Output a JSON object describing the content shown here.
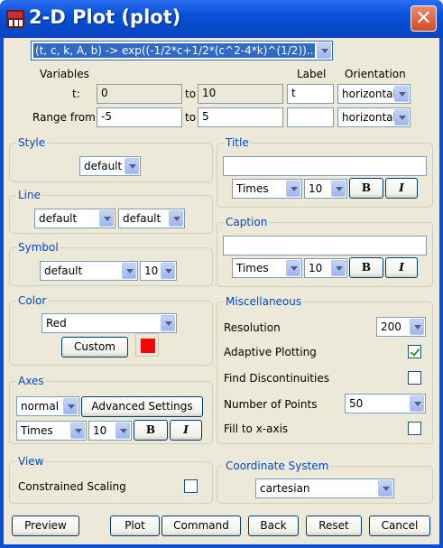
{
  "window": {
    "title": "2-D Plot (plot)",
    "close_glyph": "✕"
  },
  "expression": "(t, c, k, A, b) -> exp((-1/2*c+1/2*(c^2-4*k)^(1/2))...",
  "variables": {
    "header_variables": "Variables",
    "header_label": "Label",
    "header_orientation": "Orientation",
    "t_label": "t:",
    "t_from": "0",
    "to_word": "to",
    "t_to": "10",
    "t_axis_label": "t",
    "t_orientation": "horizontal",
    "range_label": "Range from",
    "range_from": "-5",
    "range_to": "5",
    "range_axis_label": "",
    "range_orientation": "horizontal"
  },
  "style": {
    "title": "Style",
    "value": "default"
  },
  "line": {
    "title": "Line",
    "style1": "default",
    "style2": "default"
  },
  "symbol": {
    "title": "Symbol",
    "value": "default",
    "size": "10"
  },
  "color": {
    "title": "Color",
    "value": "Red",
    "custom_label": "Custom",
    "swatch": "#ff0000"
  },
  "axes": {
    "title": "Axes",
    "type": "normal",
    "advanced_label": "Advanced Settings",
    "font": "Times",
    "size": "10",
    "bold_label": "B",
    "italic_label": "I"
  },
  "view": {
    "title": "View",
    "constrained_label": "Constrained Scaling",
    "constrained_checked": false
  },
  "title_group": {
    "title": "Title",
    "value": "",
    "font": "Times",
    "size": "10",
    "bold_label": "B",
    "italic_label": "I"
  },
  "caption_group": {
    "title": "Caption",
    "value": "",
    "font": "Times",
    "size": "10",
    "bold_label": "B",
    "italic_label": "I"
  },
  "misc": {
    "title": "Miscellaneous",
    "resolution_label": "Resolution",
    "resolution": "200",
    "adaptive_label": "Adaptive Plotting",
    "adaptive_checked": true,
    "discont_label": "Find Discontinuities",
    "discont_checked": false,
    "points_label": "Number of Points",
    "points": "50",
    "fill_label": "Fill to x-axis",
    "fill_checked": false
  },
  "coord": {
    "title": "Coordinate System",
    "value": "cartesian"
  },
  "buttons": {
    "preview": "Preview",
    "plot": "Plot",
    "command": "Command",
    "back": "Back",
    "reset": "Reset",
    "cancel": "Cancel"
  }
}
